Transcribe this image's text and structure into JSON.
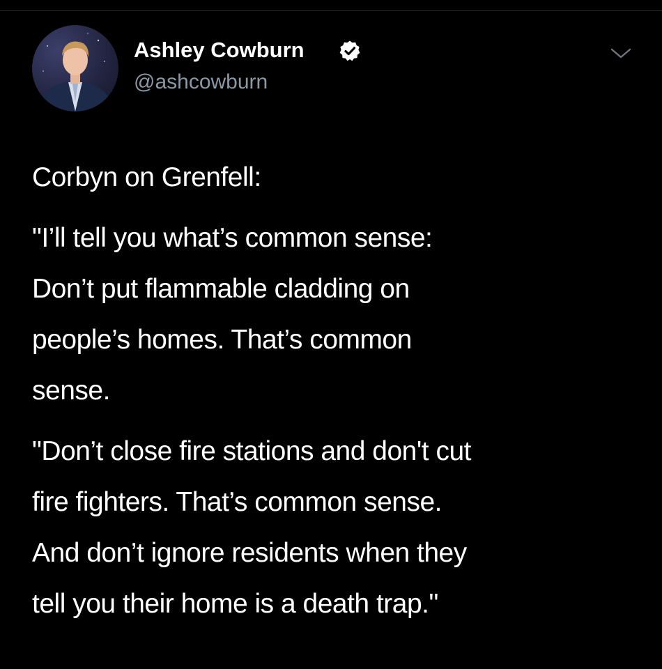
{
  "author": {
    "name": "Ashley Cowburn",
    "handle": "@ashcowburn",
    "verified": true,
    "avatar_icon": "profile-photo",
    "verified_icon": "verified-badge-icon"
  },
  "menu": {
    "icon": "chevron-down-icon"
  },
  "tweet": {
    "paragraphs": [
      {
        "lines": [
          "Corbyn on Grenfell:"
        ]
      },
      {
        "lines": [
          "\"I’ll tell you what’s common sense:",
          "Don’t put flammable cladding on",
          "people’s homes. That’s common",
          "sense."
        ]
      },
      {
        "lines": [
          "\"Don’t close fire stations and don't cut",
          "fire fighters. That’s common sense.",
          "And don’t ignore residents when they",
          "tell you their home is a death trap.\""
        ]
      }
    ]
  },
  "colors": {
    "background": "#000000",
    "text": "#ffffff",
    "secondary_text": "#8b98a5"
  }
}
